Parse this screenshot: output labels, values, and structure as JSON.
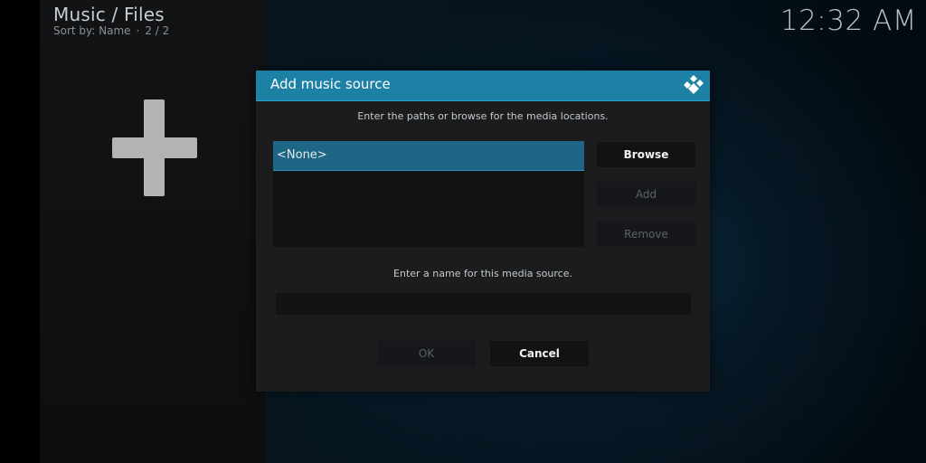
{
  "header": {
    "title": "Music / Files",
    "sort_label": "Sort by: Name",
    "separator": "·",
    "page_info": "2 / 2"
  },
  "clock": "12:32 AM",
  "left_panel": {
    "add_icon": "plus-icon"
  },
  "dialog": {
    "title": "Add music source",
    "logo_icon": "kodi-logo-icon",
    "paths_hint": "Enter the paths or browse for the media locations.",
    "paths": [
      "<None>"
    ],
    "buttons": {
      "browse": "Browse",
      "add": "Add",
      "remove": "Remove",
      "ok": "OK",
      "cancel": "Cancel"
    },
    "name_hint": "Enter a name for this media source.",
    "name_value": ""
  },
  "colors": {
    "accent": "#1d81a6",
    "selected_item": "#1d6685",
    "dialog_bg": "#1a1c1e"
  }
}
